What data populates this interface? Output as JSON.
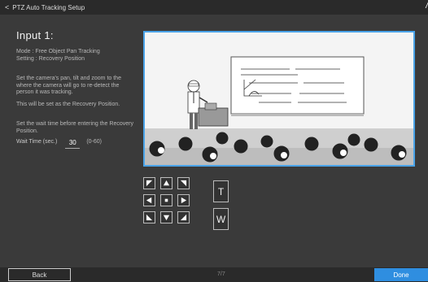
{
  "header": {
    "back_chevron": "<",
    "title": "PTZ Auto Tracking Setup",
    "trail": "/"
  },
  "input_title": "Input 1:",
  "mode_text": "Mode : Free Object Pan Tracking\nSetting : Recovery Position",
  "instruction_1": "Set the camera's pan, tilt and zoom to the where the camera will go to re-detect the person it was tracking.",
  "instruction_2": "This will be set as the Recovery Position.",
  "instruction_3": "Set the wait time before entering the Recovery Position.",
  "wait_time": {
    "label": "Wait Time (sec.)",
    "value": "30",
    "range": "(0-60)"
  },
  "zoom": {
    "tele_label": "T",
    "wide_label": "W"
  },
  "ptz_icons": [
    "up-left-arrow-icon",
    "up-arrow-icon",
    "up-right-arrow-icon",
    "left-arrow-icon",
    "home-icon",
    "right-arrow-icon",
    "down-left-arrow-icon",
    "down-arrow-icon",
    "down-right-arrow-icon"
  ],
  "footer": {
    "back_label": "Back",
    "page_indicator": "7/7",
    "done_label": "Done"
  },
  "colors": {
    "accent": "#2f8ee0",
    "preview_border": "#4aa3e8",
    "background": "#3a3a3a",
    "bar": "#2a2a2a"
  }
}
